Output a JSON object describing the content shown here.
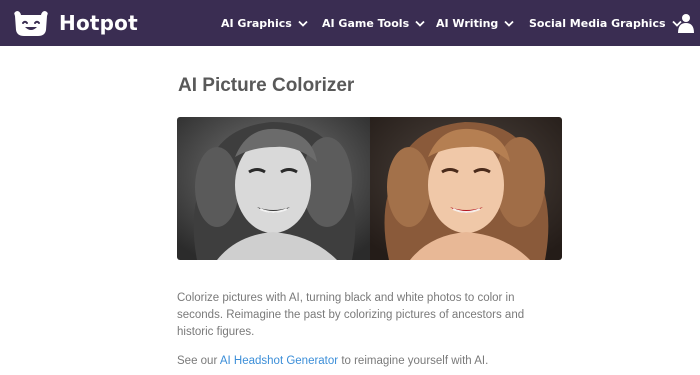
{
  "header": {
    "brand": "Hotpot",
    "nav": [
      {
        "label": "AI Graphics",
        "icon": "chevron-down-icon"
      },
      {
        "label": "AI Game Tools",
        "icon": "chevron-down-icon"
      },
      {
        "label": "AI Writing",
        "icon": "chevron-down-icon"
      },
      {
        "label": "Social Media Graphics",
        "icon": "chevron-down-icon"
      }
    ],
    "account_icon": "user-icon",
    "colors": {
      "bar": "#3a2d52",
      "text": "#ffffff"
    }
  },
  "page": {
    "title": "AI Picture Colorizer",
    "description": "Colorize pictures with AI, turning black and white photos to color in seconds. Reimagine the past by colorizing pictures of ancestors and historic figures.",
    "see_prefix": "See our",
    "see_link": "AI Headshot Generator",
    "see_suffix": "to reimagine yourself with AI.",
    "link_color": "#3b8ed8"
  }
}
